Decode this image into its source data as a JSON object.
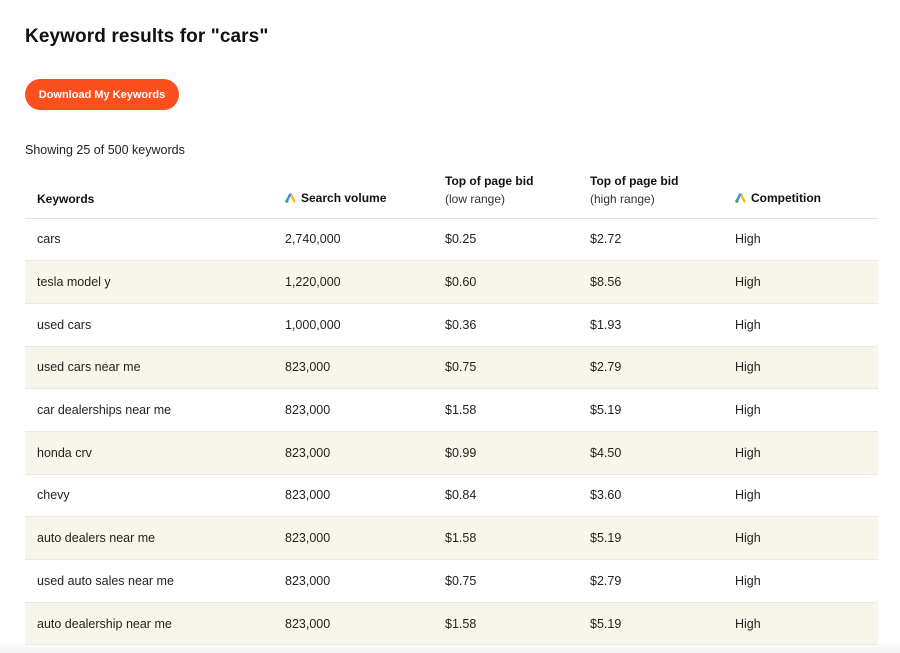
{
  "header": {
    "title": "Keyword results for \"cars\""
  },
  "actions": {
    "download_label": "Download My Keywords"
  },
  "summary": {
    "showing_text": "Showing 25 of 500 keywords"
  },
  "colors": {
    "accent": "#fb4f1e",
    "row_alt": "#f8f5ea"
  },
  "table": {
    "headers": {
      "keywords": "Keywords",
      "search_volume": "Search volume",
      "bid_low_top": "Top of page bid",
      "bid_low_sub": "(low range)",
      "bid_high_top": "Top of page bid",
      "bid_high_sub": "(high range)",
      "competition": "Competition"
    },
    "header_icons": {
      "search_volume": "google-ads-icon",
      "competition": "google-ads-icon"
    },
    "rows": [
      {
        "keyword": "cars",
        "volume": "2,740,000",
        "low": "$0.25",
        "high": "$2.72",
        "competition": "High"
      },
      {
        "keyword": "tesla model y",
        "volume": "1,220,000",
        "low": "$0.60",
        "high": "$8.56",
        "competition": "High"
      },
      {
        "keyword": "used cars",
        "volume": "1,000,000",
        "low": "$0.36",
        "high": "$1.93",
        "competition": "High"
      },
      {
        "keyword": "used cars near me",
        "volume": "823,000",
        "low": "$0.75",
        "high": "$2.79",
        "competition": "High"
      },
      {
        "keyword": "car dealerships near me",
        "volume": "823,000",
        "low": "$1.58",
        "high": "$5.19",
        "competition": "High"
      },
      {
        "keyword": "honda crv",
        "volume": "823,000",
        "low": "$0.99",
        "high": "$4.50",
        "competition": "High"
      },
      {
        "keyword": "chevy",
        "volume": "823,000",
        "low": "$0.84",
        "high": "$3.60",
        "competition": "High"
      },
      {
        "keyword": "auto dealers near me",
        "volume": "823,000",
        "low": "$1.58",
        "high": "$5.19",
        "competition": "High"
      },
      {
        "keyword": "used auto sales near me",
        "volume": "823,000",
        "low": "$0.75",
        "high": "$2.79",
        "competition": "High"
      },
      {
        "keyword": "auto dealership near me",
        "volume": "823,000",
        "low": "$1.58",
        "high": "$5.19",
        "competition": "High"
      }
    ]
  }
}
